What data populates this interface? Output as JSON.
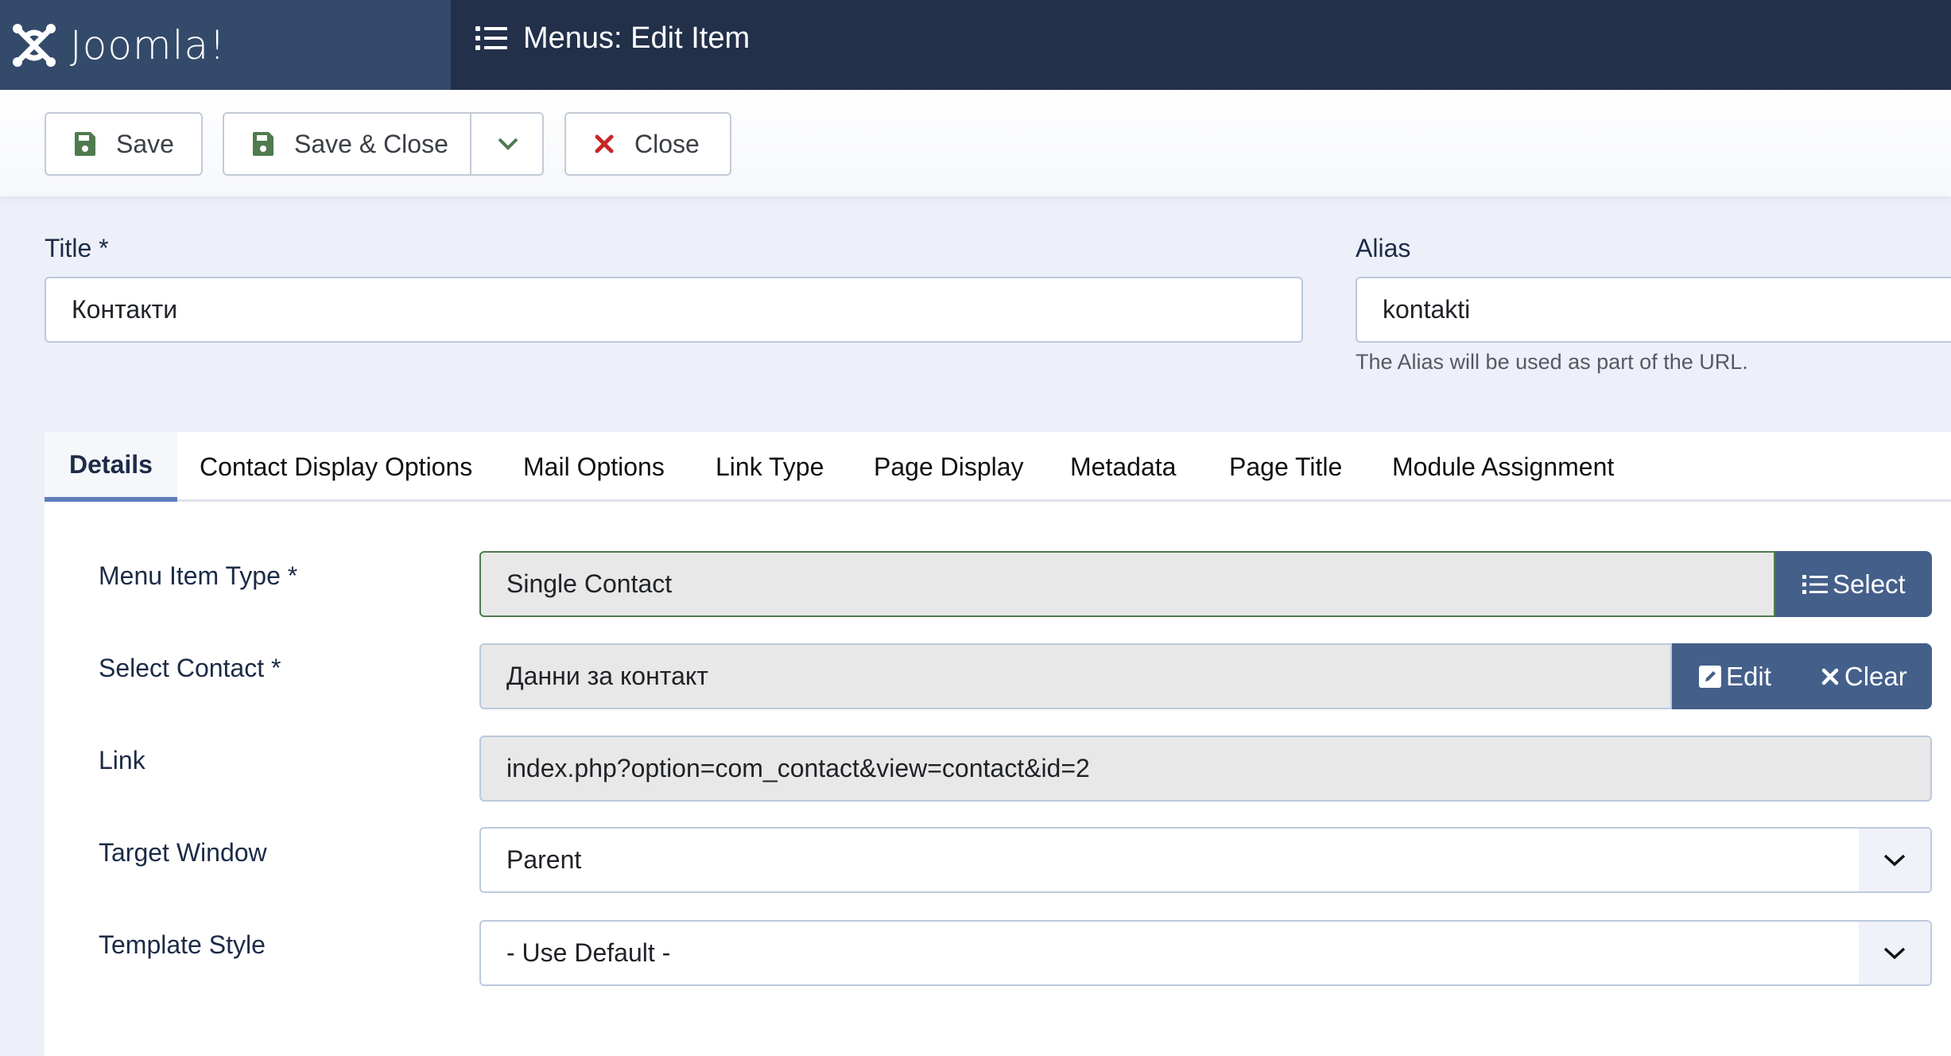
{
  "header": {
    "brand": "Joomla!",
    "page_title": "Menus: Edit Item",
    "colors": {
      "logo_panel": "#344a6b",
      "header": "#22304a"
    }
  },
  "toolbar": {
    "save_label": "Save",
    "save_close_label": "Save & Close",
    "close_label": "Close",
    "icons": {
      "save": "floppy-disk-icon",
      "dropdown": "chevron-down-icon",
      "close": "x-icon"
    },
    "colors": {
      "save_icon": "#4f7b4f",
      "close_icon": "#c52827"
    }
  },
  "form": {
    "title": {
      "label": "Title *",
      "value": "Контакти"
    },
    "alias": {
      "label": "Alias",
      "value": "kontakti",
      "help": "The Alias will be used as part of the URL."
    }
  },
  "tabs": [
    {
      "label": "Details",
      "active": true
    },
    {
      "label": "Contact Display Options",
      "active": false
    },
    {
      "label": "Mail Options",
      "active": false
    },
    {
      "label": "Link Type",
      "active": false
    },
    {
      "label": "Page Display",
      "active": false
    },
    {
      "label": "Metadata",
      "active": false
    },
    {
      "label": "Page Title",
      "active": false
    },
    {
      "label": "Module Assignment",
      "active": false
    }
  ],
  "details": {
    "menu_item_type": {
      "label": "Menu Item Type *",
      "value": "Single Contact",
      "select_label": "Select"
    },
    "select_contact": {
      "label": "Select Contact *",
      "value": "Данни за контакт",
      "edit_label": "Edit",
      "clear_label": "Clear"
    },
    "link": {
      "label": "Link",
      "value": "index.php?option=com_contact&view=contact&id=2"
    },
    "target_window": {
      "label": "Target Window",
      "value": "Parent"
    },
    "template_style": {
      "label": "Template Style",
      "value": "- Use Default -"
    },
    "colors": {
      "action_button": "#445f8a",
      "active_tab_underline": "#5d7fb9"
    }
  }
}
